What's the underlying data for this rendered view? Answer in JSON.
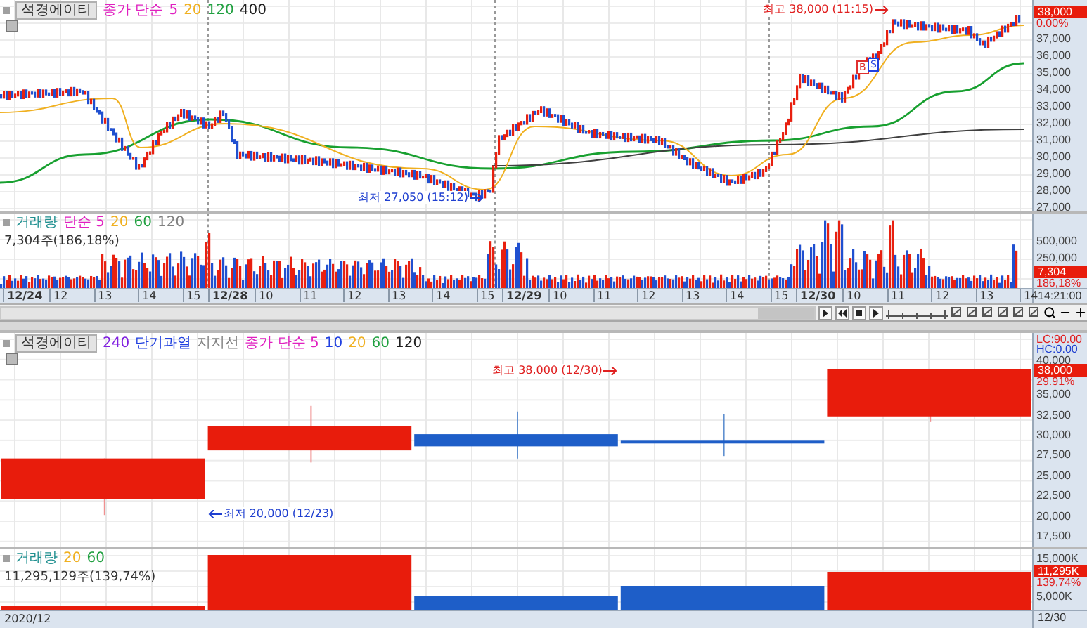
{
  "top_chart": {
    "title": "석경에이티",
    "legend": [
      {
        "text": "종가 단순",
        "color": "#e020c0"
      },
      {
        "text": "5",
        "color": "#e020c0"
      },
      {
        "text": "20",
        "color": "#f0b020"
      },
      {
        "text": "120",
        "color": "#20a040"
      },
      {
        "text": "400",
        "color": "#202020"
      }
    ],
    "ticks": [
      "37,000",
      "36,000",
      "35,000",
      "34,000",
      "33,000",
      "32,000",
      "31,000",
      "30,000",
      "29,000",
      "28,000",
      "27,000"
    ],
    "current_price": "38,000",
    "change": "0.00%",
    "high_note": "최고 38,000 (11:15)",
    "low_note": "최저 27,050 (15:12)",
    "trade_markers": [
      {
        "text": "B",
        "color": "#e03030"
      },
      {
        "text": "S",
        "color": "#2040e0"
      }
    ]
  },
  "volume_panel": {
    "legend": [
      {
        "text": "거래량",
        "color": "#209090"
      },
      {
        "text": "단순 5",
        "color": "#e020c0"
      },
      {
        "text": "20",
        "color": "#f0b020"
      },
      {
        "text": "60",
        "color": "#20a040"
      },
      {
        "text": "120",
        "color": "#808080"
      }
    ],
    "reading": "7,304주(186,18%)",
    "ticks": [
      "500,000",
      "250,000"
    ],
    "current": "7,304",
    "change": "186,18%"
  },
  "time_axis": {
    "days": [
      {
        "date": "12/24",
        "hours": [
          "12",
          "13",
          "14",
          "15"
        ]
      },
      {
        "date": "12/28",
        "hours": [
          "10",
          "11",
          "12",
          "13",
          "14",
          "15"
        ]
      },
      {
        "date": "12/29",
        "hours": [
          "10",
          "11",
          "12",
          "13",
          "14",
          "15"
        ]
      },
      {
        "date": "12/30",
        "hours": [
          "10",
          "11",
          "12",
          "13",
          "14"
        ]
      }
    ],
    "time": "14:21:00"
  },
  "daily_chart": {
    "title": "석경에이티",
    "legend": [
      {
        "text": "240",
        "color": "#8020e0"
      },
      {
        "text": "단기과열",
        "color": "#2040e0"
      },
      {
        "text": "지지선",
        "color": "#808080"
      },
      {
        "text": "종가 단순 5",
        "color": "#e020c0"
      },
      {
        "text": "10",
        "color": "#2040e0"
      },
      {
        "text": "20",
        "color": "#f0b020"
      },
      {
        "text": "60",
        "color": "#20a040"
      },
      {
        "text": "120",
        "color": "#202020"
      }
    ],
    "lc": "LC:90.00",
    "hc": "HC:0.00",
    "ticks": [
      "40,000",
      "35,000",
      "32,500",
      "30,000",
      "27,500",
      "25,000",
      "22,500",
      "20,000",
      "17,500"
    ],
    "current_price": "38,000",
    "change": "29.91%",
    "high_note": "최고 38,000 (12/30)",
    "low_note": "최저 20,000 (12/23)"
  },
  "daily_volume": {
    "legend": [
      {
        "text": "거래량",
        "color": "#209090"
      },
      {
        "text": "20",
        "color": "#f0b020"
      },
      {
        "text": "60",
        "color": "#20a040"
      }
    ],
    "reading": "11,295,129주(139,74%)",
    "ticks": [
      "15,000K",
      "5,000K"
    ],
    "current": "11,295K",
    "change": "139,74%"
  },
  "bottom_axis": {
    "period": "2020/12",
    "date": "12/30"
  }
}
